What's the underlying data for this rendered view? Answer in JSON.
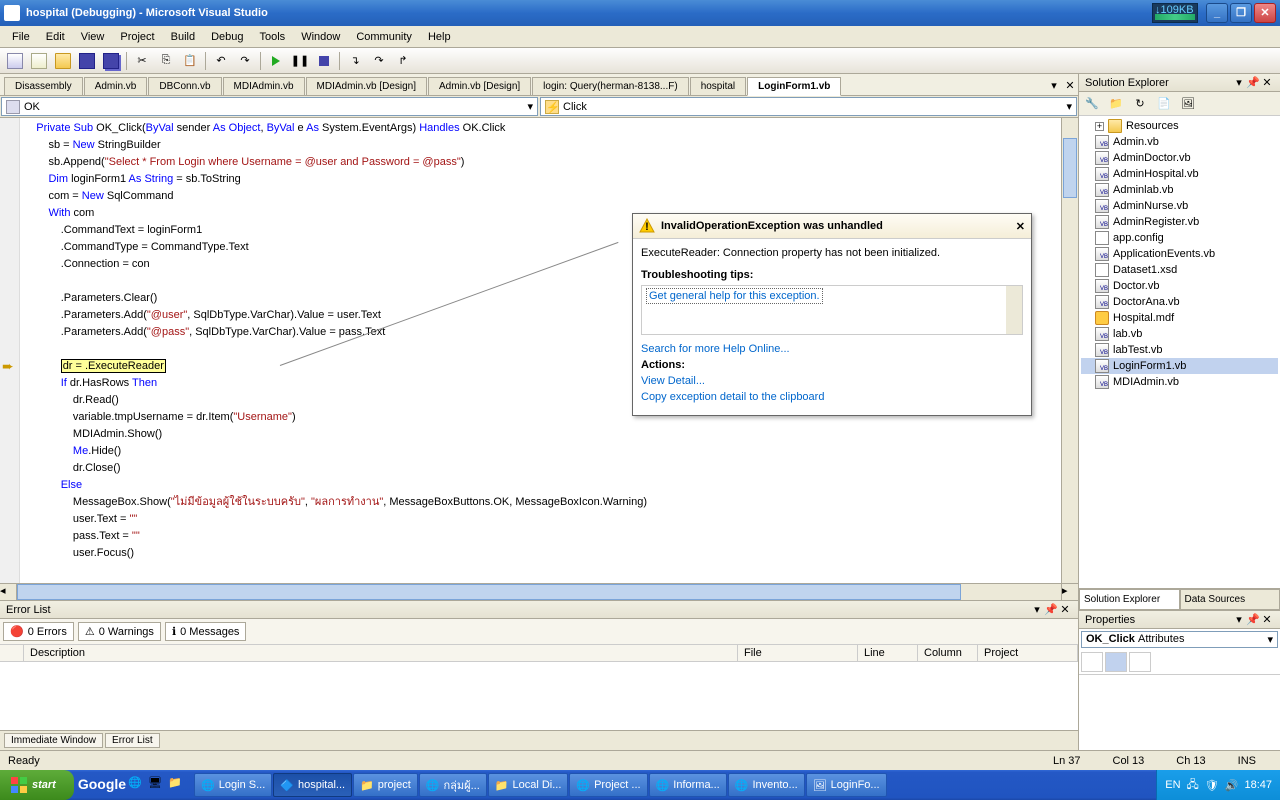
{
  "title": "hospital (Debugging) - Microsoft Visual Studio",
  "perf_label": "↓109KB",
  "menu": [
    "File",
    "Edit",
    "View",
    "Project",
    "Build",
    "Debug",
    "Tools",
    "Window",
    "Community",
    "Help"
  ],
  "doc_tabs": [
    "Disassembly",
    "Admin.vb",
    "DBConn.vb",
    "MDIAdmin.vb",
    "MDIAdmin.vb [Design]",
    "Admin.vb [Design]",
    "login: Query(herman-8138...F)",
    "hospital",
    "LoginForm1.vb"
  ],
  "doc_tab_active": 8,
  "nav_left": "OK",
  "nav_right": "Click",
  "code_lines": [
    {
      "indent": 1,
      "tokens": [
        {
          "t": "Private Sub",
          "c": "kw"
        },
        {
          "t": " OK_Click("
        },
        {
          "t": "ByVal",
          "c": "kw"
        },
        {
          "t": " sender "
        },
        {
          "t": "As",
          "c": "kw"
        },
        {
          "t": " "
        },
        {
          "t": "Object",
          "c": "kw"
        },
        {
          "t": ", "
        },
        {
          "t": "ByVal",
          "c": "kw"
        },
        {
          "t": " e "
        },
        {
          "t": "As",
          "c": "kw"
        },
        {
          "t": " System.EventArgs) "
        },
        {
          "t": "Handles",
          "c": "kw"
        },
        {
          "t": " OK.Click"
        }
      ]
    },
    {
      "indent": 2,
      "tokens": [
        {
          "t": "sb = "
        },
        {
          "t": "New",
          "c": "kw"
        },
        {
          "t": " StringBuilder"
        }
      ]
    },
    {
      "indent": 2,
      "tokens": [
        {
          "t": "sb.Append("
        },
        {
          "t": "\"Select * From Login where Username = @user and Password = @pass\"",
          "c": "str"
        },
        {
          "t": ")"
        }
      ]
    },
    {
      "indent": 2,
      "tokens": [
        {
          "t": "Dim",
          "c": "kw"
        },
        {
          "t": " loginForm1 "
        },
        {
          "t": "As",
          "c": "kw"
        },
        {
          "t": " "
        },
        {
          "t": "String",
          "c": "kw"
        },
        {
          "t": " = sb.ToString"
        }
      ]
    },
    {
      "indent": 2,
      "tokens": [
        {
          "t": "com = "
        },
        {
          "t": "New",
          "c": "kw"
        },
        {
          "t": " SqlCommand"
        }
      ]
    },
    {
      "indent": 2,
      "tokens": [
        {
          "t": "With",
          "c": "kw"
        },
        {
          "t": " com"
        }
      ]
    },
    {
      "indent": 3,
      "tokens": [
        {
          "t": ".CommandText = loginForm1"
        }
      ]
    },
    {
      "indent": 3,
      "tokens": [
        {
          "t": ".CommandType = CommandType.Text"
        }
      ]
    },
    {
      "indent": 3,
      "tokens": [
        {
          "t": ".Connection = con"
        }
      ]
    },
    {
      "indent": 3,
      "tokens": [
        {
          "t": ""
        }
      ]
    },
    {
      "indent": 3,
      "tokens": [
        {
          "t": ".Parameters.Clear()"
        }
      ]
    },
    {
      "indent": 3,
      "tokens": [
        {
          "t": ".Parameters.Add("
        },
        {
          "t": "\"@user\"",
          "c": "str"
        },
        {
          "t": ", SqlDbType.VarChar).Value = user.Text"
        }
      ]
    },
    {
      "indent": 3,
      "tokens": [
        {
          "t": ".Parameters.Add("
        },
        {
          "t": "\"@pass\"",
          "c": "str"
        },
        {
          "t": ", SqlDbType.VarChar).Value = pass.Text"
        }
      ]
    },
    {
      "indent": 3,
      "tokens": [
        {
          "t": ""
        }
      ]
    },
    {
      "indent": 3,
      "tokens": [
        {
          "t": "dr = .ExecuteReader",
          "hl": true
        }
      ]
    },
    {
      "indent": 3,
      "tokens": [
        {
          "t": "If",
          "c": "kw"
        },
        {
          "t": " dr.HasRows "
        },
        {
          "t": "Then",
          "c": "kw"
        }
      ]
    },
    {
      "indent": 4,
      "tokens": [
        {
          "t": "dr.Read()"
        }
      ]
    },
    {
      "indent": 4,
      "tokens": [
        {
          "t": "variable.tmpUsername = dr.Item("
        },
        {
          "t": "\"Username\"",
          "c": "str"
        },
        {
          "t": ")"
        }
      ]
    },
    {
      "indent": 4,
      "tokens": [
        {
          "t": "MDIAdmin.Show()"
        }
      ]
    },
    {
      "indent": 4,
      "tokens": [
        {
          "t": "Me",
          "c": "kw"
        },
        {
          "t": ".Hide()"
        }
      ]
    },
    {
      "indent": 4,
      "tokens": [
        {
          "t": "dr.Close()"
        }
      ]
    },
    {
      "indent": 3,
      "tokens": [
        {
          "t": "Else",
          "c": "kw"
        }
      ]
    },
    {
      "indent": 4,
      "tokens": [
        {
          "t": "MessageBox.Show("
        },
        {
          "t": "\"ไม่มีข้อมูลผู้ใช้ในระบบครับ\"",
          "c": "str"
        },
        {
          "t": ", "
        },
        {
          "t": "\"ผลการทำงาน\"",
          "c": "str"
        },
        {
          "t": ", MessageBoxButtons.OK, MessageBoxIcon.Warning)"
        }
      ]
    },
    {
      "indent": 4,
      "tokens": [
        {
          "t": "user.Text = "
        },
        {
          "t": "\"\"",
          "c": "str"
        }
      ]
    },
    {
      "indent": 4,
      "tokens": [
        {
          "t": "pass.Text = "
        },
        {
          "t": "\"\"",
          "c": "str"
        }
      ]
    },
    {
      "indent": 4,
      "tokens": [
        {
          "t": "user.Focus()"
        }
      ]
    }
  ],
  "arrow_line": 14,
  "exception": {
    "title": "InvalidOperationException was unhandled",
    "message": "ExecuteReader: Connection property has not been initialized.",
    "tips_title": "Troubleshooting tips:",
    "tip_link": "Get general help for this exception.",
    "search_link": "Search for more Help Online...",
    "actions_title": "Actions:",
    "view_detail": "View Detail...",
    "copy_detail": "Copy exception detail to the clipboard"
  },
  "error_list": {
    "title": "Error List",
    "buttons": [
      {
        "icon": "error",
        "label": "0 Errors"
      },
      {
        "icon": "warn",
        "label": "0 Warnings"
      },
      {
        "icon": "info",
        "label": "0 Messages"
      }
    ],
    "columns": [
      "",
      "Description",
      "File",
      "Line",
      "Column",
      "Project"
    ]
  },
  "bottom_tabs": [
    "Immediate Window",
    "Error List"
  ],
  "solution_explorer": {
    "title": "Solution Explorer",
    "items": [
      {
        "name": "Resources",
        "icon": "folder",
        "expand": "+",
        "indent": 0
      },
      {
        "name": "Admin.vb",
        "icon": "vb",
        "indent": 0
      },
      {
        "name": "AdminDoctor.vb",
        "icon": "vb",
        "indent": 0
      },
      {
        "name": "AdminHospital.vb",
        "icon": "vb",
        "indent": 0
      },
      {
        "name": "Adminlab.vb",
        "icon": "vb",
        "indent": 0
      },
      {
        "name": "AdminNurse.vb",
        "icon": "vb",
        "indent": 0
      },
      {
        "name": "AdminRegister.vb",
        "icon": "vb",
        "indent": 0
      },
      {
        "name": "app.config",
        "icon": "cfg",
        "indent": 0
      },
      {
        "name": "ApplicationEvents.vb",
        "icon": "vb",
        "indent": 0
      },
      {
        "name": "Dataset1.xsd",
        "icon": "xsd",
        "indent": 0
      },
      {
        "name": "Doctor.vb",
        "icon": "vb",
        "indent": 0
      },
      {
        "name": "DoctorAna.vb",
        "icon": "vb",
        "indent": 0
      },
      {
        "name": "Hospital.mdf",
        "icon": "db",
        "indent": 0
      },
      {
        "name": "lab.vb",
        "icon": "vb",
        "indent": 0
      },
      {
        "name": "labTest.vb",
        "icon": "vb",
        "indent": 0
      },
      {
        "name": "LoginForm1.vb",
        "icon": "vb",
        "indent": 0,
        "selected": true
      },
      {
        "name": "MDIAdmin.vb",
        "icon": "vb",
        "indent": 0
      }
    ]
  },
  "right_tabs": [
    "Solution Explorer",
    "Data Sources"
  ],
  "properties": {
    "title": "Properties",
    "obj": "OK_Click",
    "obj2": "Attributes"
  },
  "status": {
    "ready": "Ready",
    "ln": "Ln 37",
    "col": "Col 13",
    "ch": "Ch 13",
    "ins": "INS"
  },
  "taskbar": {
    "start": "start",
    "google": "Google",
    "items": [
      {
        "label": "Login S...",
        "icon": "ie"
      },
      {
        "label": "hospital...",
        "icon": "vs",
        "active": true
      },
      {
        "label": "project",
        "icon": "folder"
      },
      {
        "label": "กลุ่มผู้...",
        "icon": "ie"
      },
      {
        "label": "Local Di...",
        "icon": "folder"
      },
      {
        "label": "Project ...",
        "icon": "ie"
      },
      {
        "label": "Informa...",
        "icon": "ie"
      },
      {
        "label": "Invento...",
        "icon": "ie"
      },
      {
        "label": "LoginFo...",
        "icon": "img"
      }
    ],
    "tray_lang": "EN",
    "tray_time": "18:47"
  }
}
